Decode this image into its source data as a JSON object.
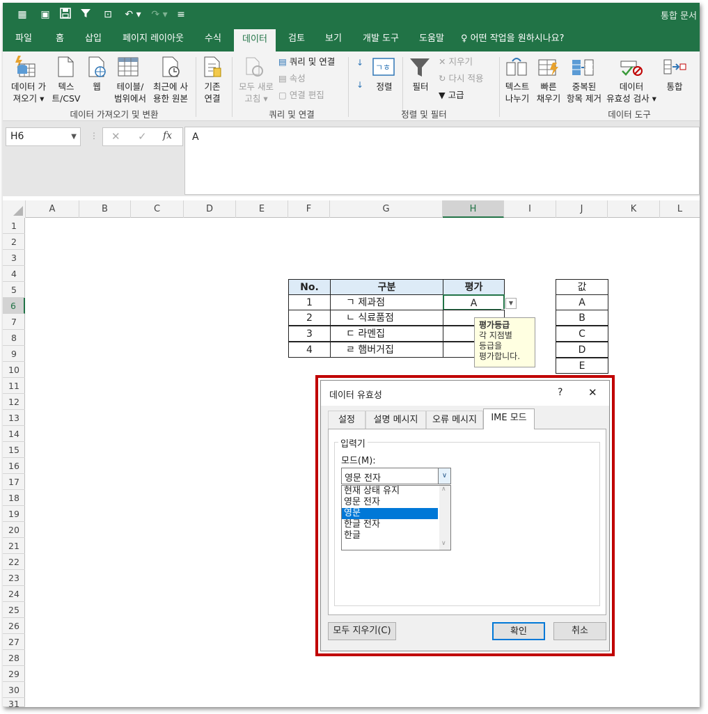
{
  "window": {
    "title": "통합 문서"
  },
  "quick_access": {
    "icons": [
      "app-icon",
      "image-icon",
      "save-icon",
      "filter-icon",
      "pivot-icon",
      "undo-icon",
      "redo-icon",
      "customize-icon"
    ]
  },
  "tabs": [
    "파일",
    "홈",
    "삽입",
    "페이지 레이아웃",
    "수식",
    "데이터",
    "검토",
    "보기",
    "개발 도구",
    "도움말"
  ],
  "active_tab": "데이터",
  "tell_me": "어떤 작업을 원하시나요?",
  "ribbon": {
    "get_data": {
      "l1": "데이터 가",
      "l2": "져오기 ▾"
    },
    "text_csv": {
      "l1": "텍스",
      "l2": "트/CSV"
    },
    "web": {
      "l1": "웹"
    },
    "table_range": {
      "l1": "테이블/",
      "l2": "범위에서"
    },
    "recent": {
      "l1": "최근에 사",
      "l2": "용한 원본"
    },
    "existing": {
      "l1": "기존",
      "l2": "연결"
    },
    "refresh_all": {
      "l1": "모두 새로",
      "l2": "고침 ▾"
    },
    "queries": "쿼리 및 연결",
    "properties": "속성",
    "edit_links": "연결 편집",
    "sort": "정렬",
    "filter": "필터",
    "clear": "지우기",
    "reapply": "다시 적용",
    "advanced": "고급",
    "text_to_columns": {
      "l1": "텍스트",
      "l2": "나누기"
    },
    "flash_fill": {
      "l1": "빠른",
      "l2": "채우기"
    },
    "remove_dup": {
      "l1": "중복된",
      "l2": "항목 제거"
    },
    "validation": {
      "l1": "데이터",
      "l2": "유효성 검사 ▾"
    },
    "consolidate": {
      "l1": "통합"
    },
    "groups": {
      "get": "데이터 가져오기 및 변환",
      "queries": "쿼리 및 연결",
      "sort": "정렬 및 필터",
      "tools": "데이터 도구"
    }
  },
  "formula_bar": {
    "name_box": "H6",
    "formula": "A"
  },
  "columns": [
    "A",
    "B",
    "C",
    "D",
    "E",
    "F",
    "G",
    "H",
    "I",
    "J",
    "K",
    "L"
  ],
  "rows": [
    "1",
    "2",
    "3",
    "4",
    "5",
    "6",
    "7",
    "8",
    "9",
    "10",
    "11",
    "12",
    "13",
    "14",
    "15",
    "16",
    "17",
    "18",
    "19",
    "20",
    "21",
    "22",
    "23",
    "24",
    "25",
    "26",
    "27",
    "28",
    "29",
    "30",
    "31"
  ],
  "table": {
    "headers": [
      "No.",
      "구분",
      "평가"
    ],
    "rows": [
      {
        "no": "1",
        "name": "ㄱ 제과점",
        "grade": "A"
      },
      {
        "no": "2",
        "name": "ㄴ 식료품점",
        "grade": ""
      },
      {
        "no": "3",
        "name": "ㄷ 라멘집",
        "grade": ""
      },
      {
        "no": "4",
        "name": "ㄹ 햄버거집",
        "grade": ""
      }
    ]
  },
  "values_list": {
    "header": "값",
    "items": [
      "A",
      "B",
      "C",
      "D",
      "E"
    ]
  },
  "tooltip": {
    "title": "평가등급",
    "lines": [
      "각 지점별",
      "등급을",
      "평가합니다."
    ]
  },
  "dialog": {
    "title": "데이터 유효성",
    "help": "?",
    "close": "✕",
    "tabs": [
      "설정",
      "설명 메시지",
      "오류 메시지",
      "IME 모드"
    ],
    "active_tab": "IME 모드",
    "group_label": "입력기",
    "mode_label": "모드(M):",
    "selected_value": "영문 전자",
    "options": [
      "현재 상태 유지",
      "영문 전자",
      "영문",
      "한글 전자",
      "한글"
    ],
    "highlighted_option": "영문",
    "clear_all": "모두 지우기(C)",
    "ok": "확인",
    "cancel": "취소"
  },
  "colors": {
    "excel_green": "#217346",
    "highlight_blue": "#0078d7",
    "red_frame": "#c00000",
    "header_fill": "#ddebf7"
  }
}
